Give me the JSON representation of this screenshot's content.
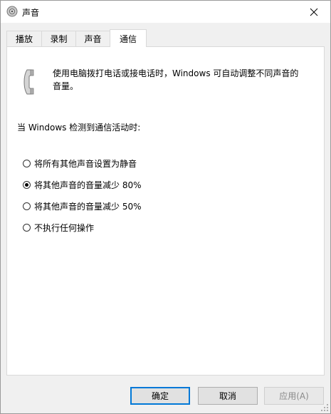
{
  "window": {
    "title": "声音"
  },
  "tabs": [
    {
      "label": "播放"
    },
    {
      "label": "录制"
    },
    {
      "label": "声音"
    },
    {
      "label": "通信"
    }
  ],
  "panel": {
    "description": "使用电脑拨打电话或接电话时，Windows 可自动调整不同声音的音量。",
    "section_label": "当 Windows 检测到通信活动时:",
    "options": [
      {
        "label": "将所有其他声音设置为静音",
        "selected": false
      },
      {
        "label": "将其他声音的音量减少 80%",
        "selected": true
      },
      {
        "label": "将其他声音的音量减少 50%",
        "selected": false
      },
      {
        "label": "不执行任何操作",
        "selected": false
      }
    ]
  },
  "buttons": {
    "ok": "确定",
    "cancel": "取消",
    "apply": "应用(A)"
  },
  "colors": {
    "accent": "#0078d7"
  }
}
